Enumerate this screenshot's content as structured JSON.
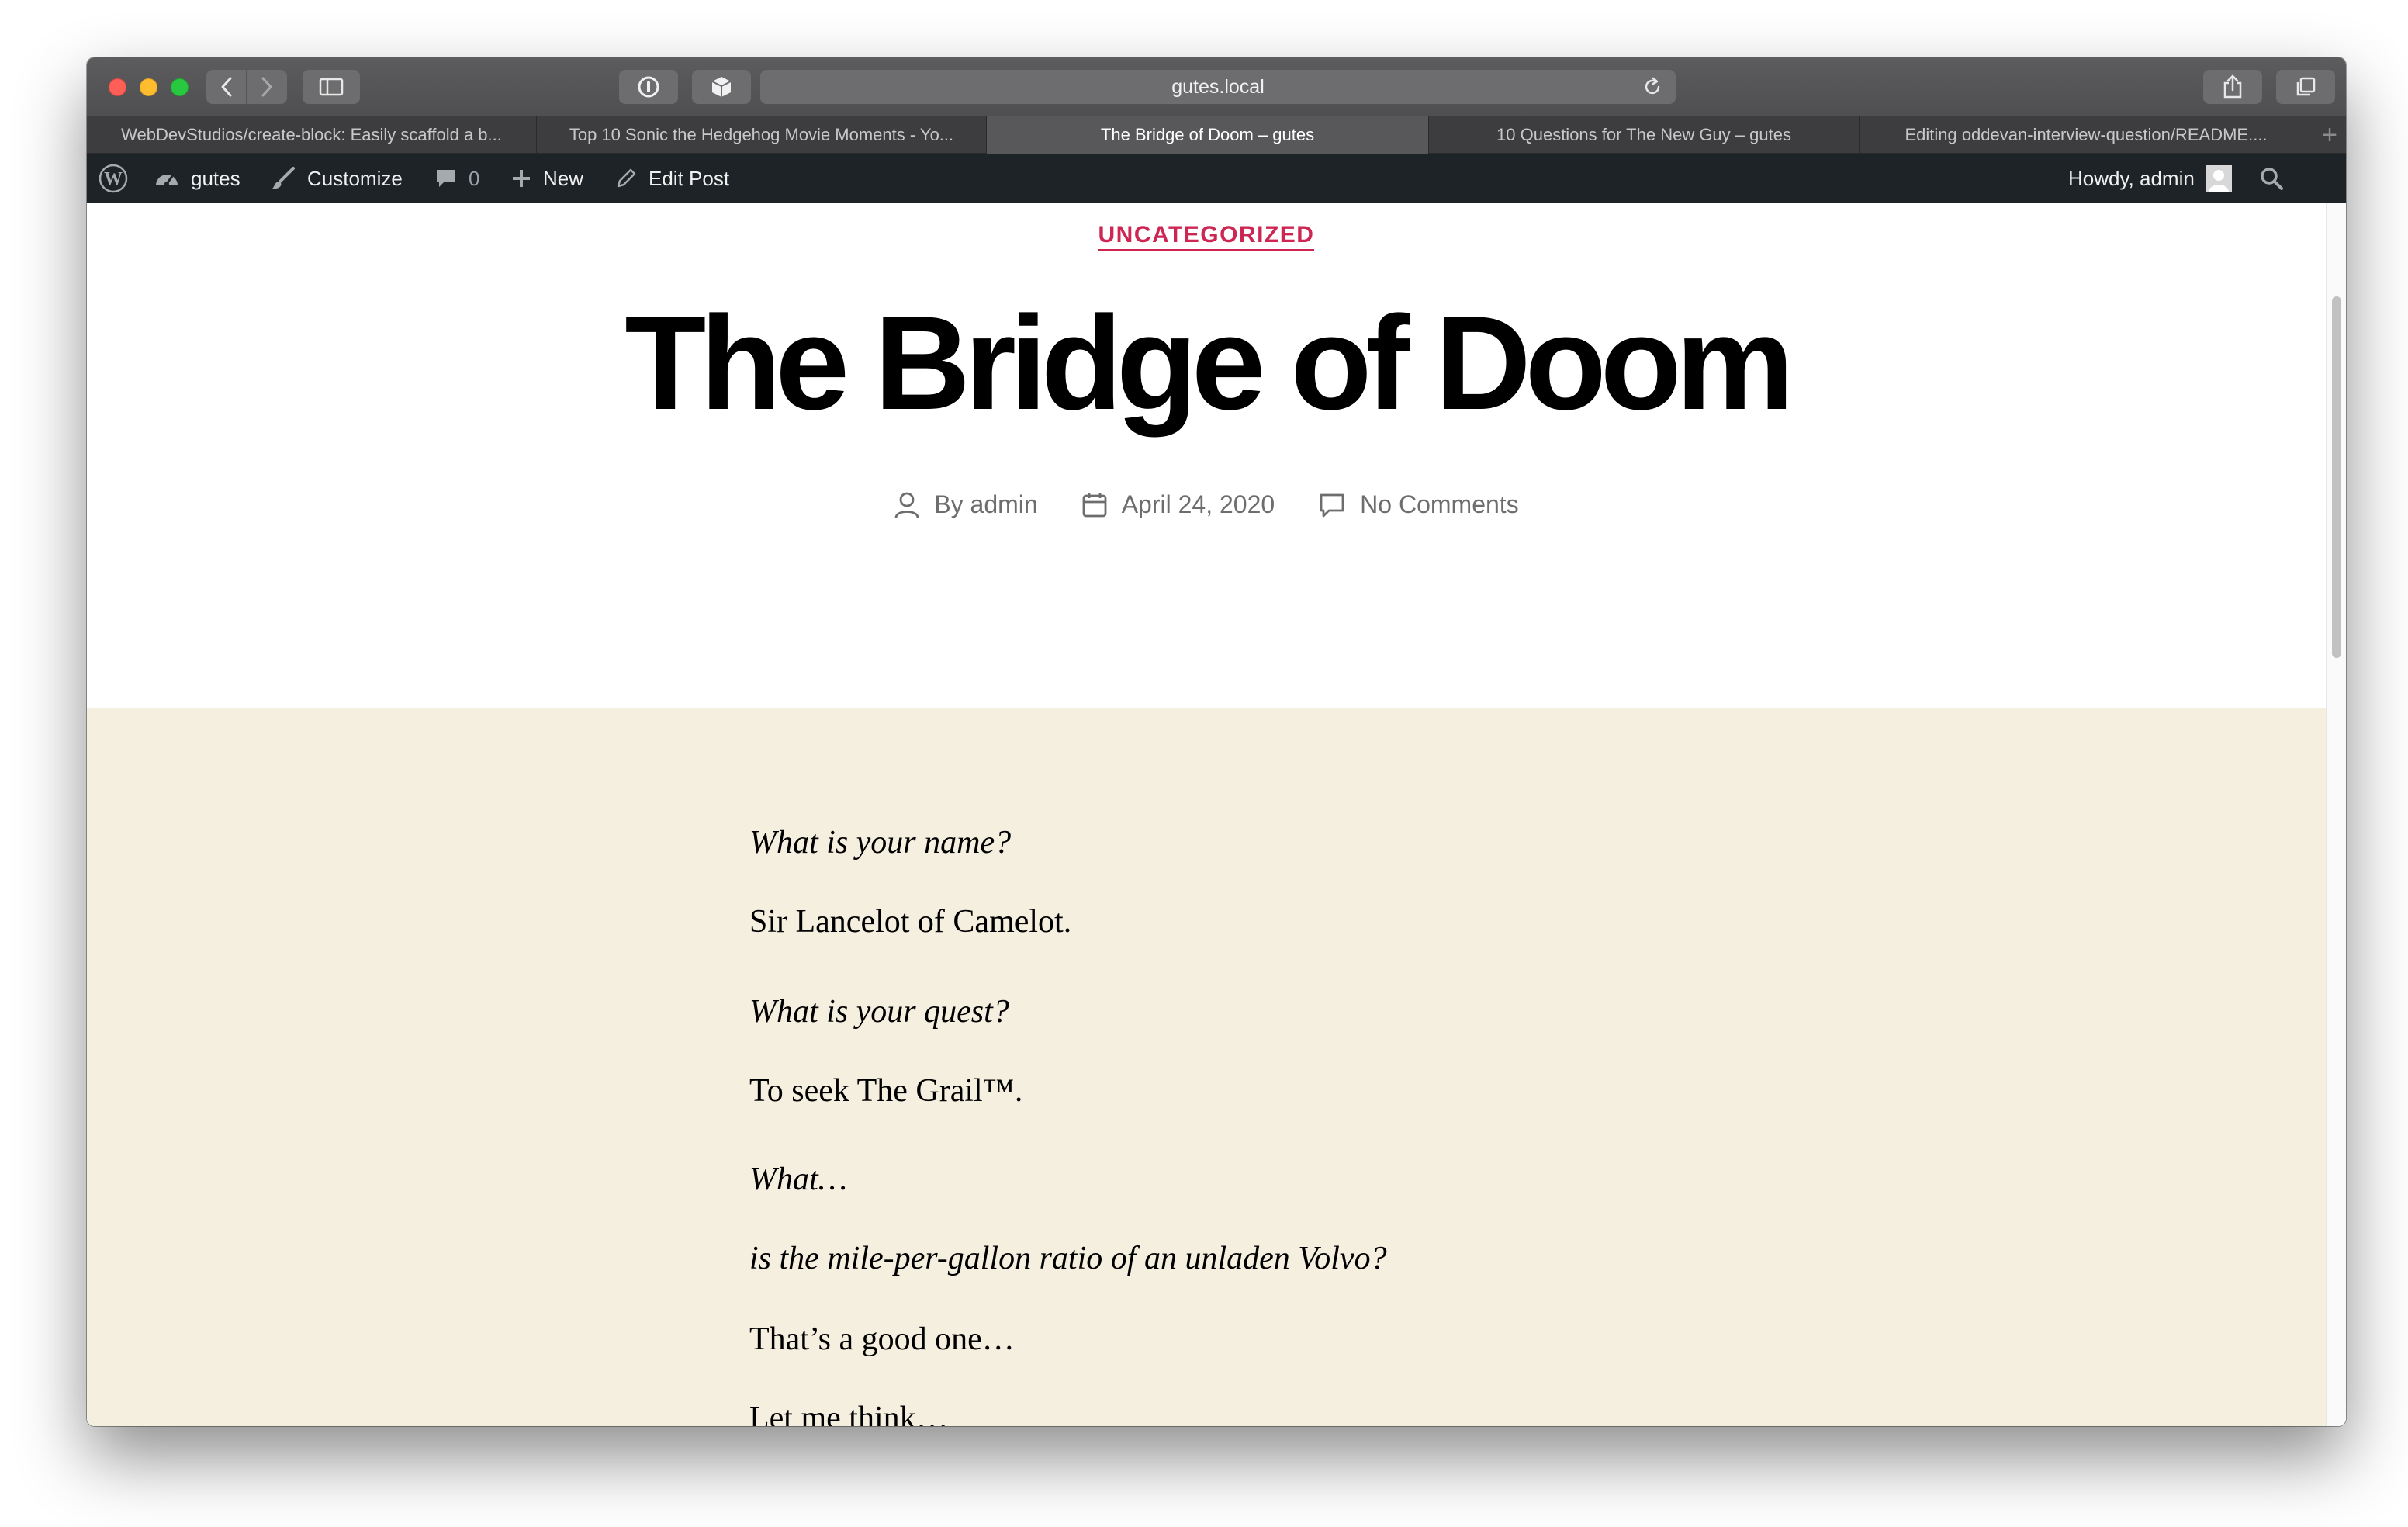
{
  "browser": {
    "url": "gutes.local",
    "tabs": [
      {
        "label": "WebDevStudios/create-block: Easily scaffold a b...",
        "active": false
      },
      {
        "label": "Top 10 Sonic the Hedgehog Movie Moments - Yo...",
        "active": false
      },
      {
        "label": "The Bridge of Doom – gutes",
        "active": true
      },
      {
        "label": "10 Questions for The New Guy – gutes",
        "active": false
      },
      {
        "label": "Editing oddevan-interview-question/README....",
        "active": false
      }
    ]
  },
  "adminbar": {
    "site_name": "gutes",
    "customize": "Customize",
    "comments_count": "0",
    "new": "New",
    "edit_post": "Edit Post",
    "howdy": "Howdy, admin"
  },
  "post": {
    "category": "UNCATEGORIZED",
    "title": "The Bridge of Doom",
    "author": "By admin",
    "date": "April 24, 2020",
    "comments": "No Comments"
  },
  "content": {
    "lines": [
      {
        "text": "What is your name?",
        "style": "italic"
      },
      {
        "text": "Sir Lancelot of Camelot.",
        "style": "normal"
      },
      {
        "text": "What is your quest?",
        "style": "italic"
      },
      {
        "text": "To seek The Grail™.",
        "style": "normal"
      },
      {
        "text": "What…",
        "style": "italic"
      },
      {
        "text": "is the mile-per-gallon ratio of an unladen Volvo?",
        "style": "italic"
      },
      {
        "text": "That’s a good one…",
        "style": "normal"
      },
      {
        "text": "Let me think…",
        "style": "normal"
      }
    ]
  },
  "colors": {
    "accent": "#cd2653",
    "cover_background": "#f5efe0",
    "adminbar_background": "#1d2327"
  },
  "icons": [
    "close-icon",
    "minimize-icon",
    "zoom-icon",
    "back-icon",
    "forward-icon",
    "sidebar-icon",
    "password-icon",
    "extension-icon",
    "reload-icon",
    "share-icon",
    "tabs-overview-icon",
    "wordpress-icon",
    "dashboard-icon",
    "brush-icon",
    "comment-icon",
    "plus-icon",
    "pencil-icon",
    "avatar-icon",
    "search-icon",
    "user-icon",
    "calendar-icon",
    "comment-bubble-icon"
  ]
}
